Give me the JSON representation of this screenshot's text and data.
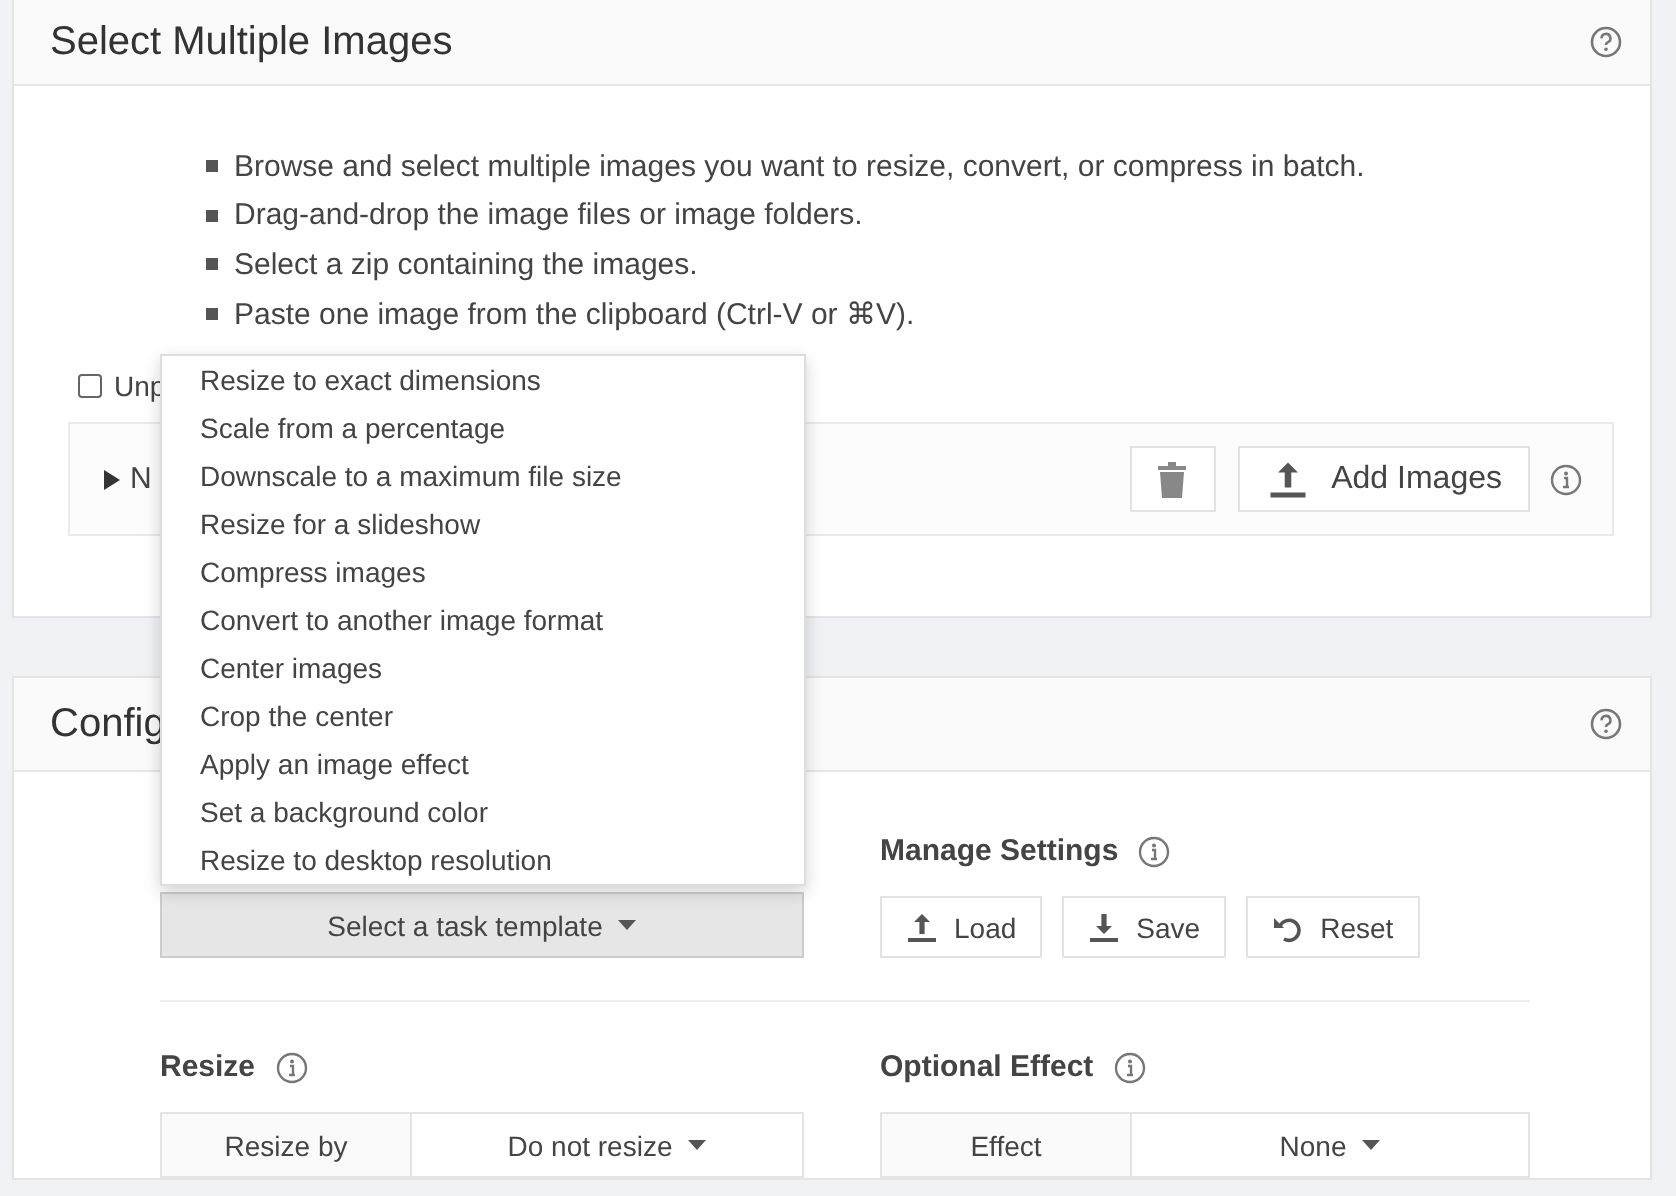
{
  "select_panel": {
    "title": "Select Multiple Images",
    "instructions": [
      "Browse and select multiple images you want to resize, convert, or compress in batch.",
      "Drag-and-drop the image files or image folders.",
      "Select a zip containing the images.",
      "Paste one image from the clipboard (Ctrl-V or ⌘V)."
    ],
    "checkbox": {
      "label": "Unp",
      "checked": false
    },
    "file_list": {
      "label": "N",
      "expanded": false
    },
    "add_button": "Add Images"
  },
  "config_panel": {
    "title": "Config",
    "template_button": "Select a task template",
    "manage_settings": {
      "label": "Manage Settings",
      "buttons": [
        {
          "kind": "load",
          "label": "Load"
        },
        {
          "kind": "save",
          "label": "Save"
        },
        {
          "kind": "reset",
          "label": "Reset"
        }
      ]
    },
    "resize": {
      "label": "Resize",
      "field": "Resize by",
      "value": "Do not resize"
    },
    "effect": {
      "label": "Optional Effect",
      "field": "Effect",
      "value": "None"
    }
  },
  "template_menu": [
    "Resize to exact dimensions",
    "Scale from a percentage",
    "Downscale to a maximum file size",
    "Resize for a slideshow",
    "Compress images",
    "Convert to another image format",
    "Center images",
    "Crop the center",
    "Apply an image effect",
    "Set a background color",
    "Resize to desktop resolution"
  ]
}
